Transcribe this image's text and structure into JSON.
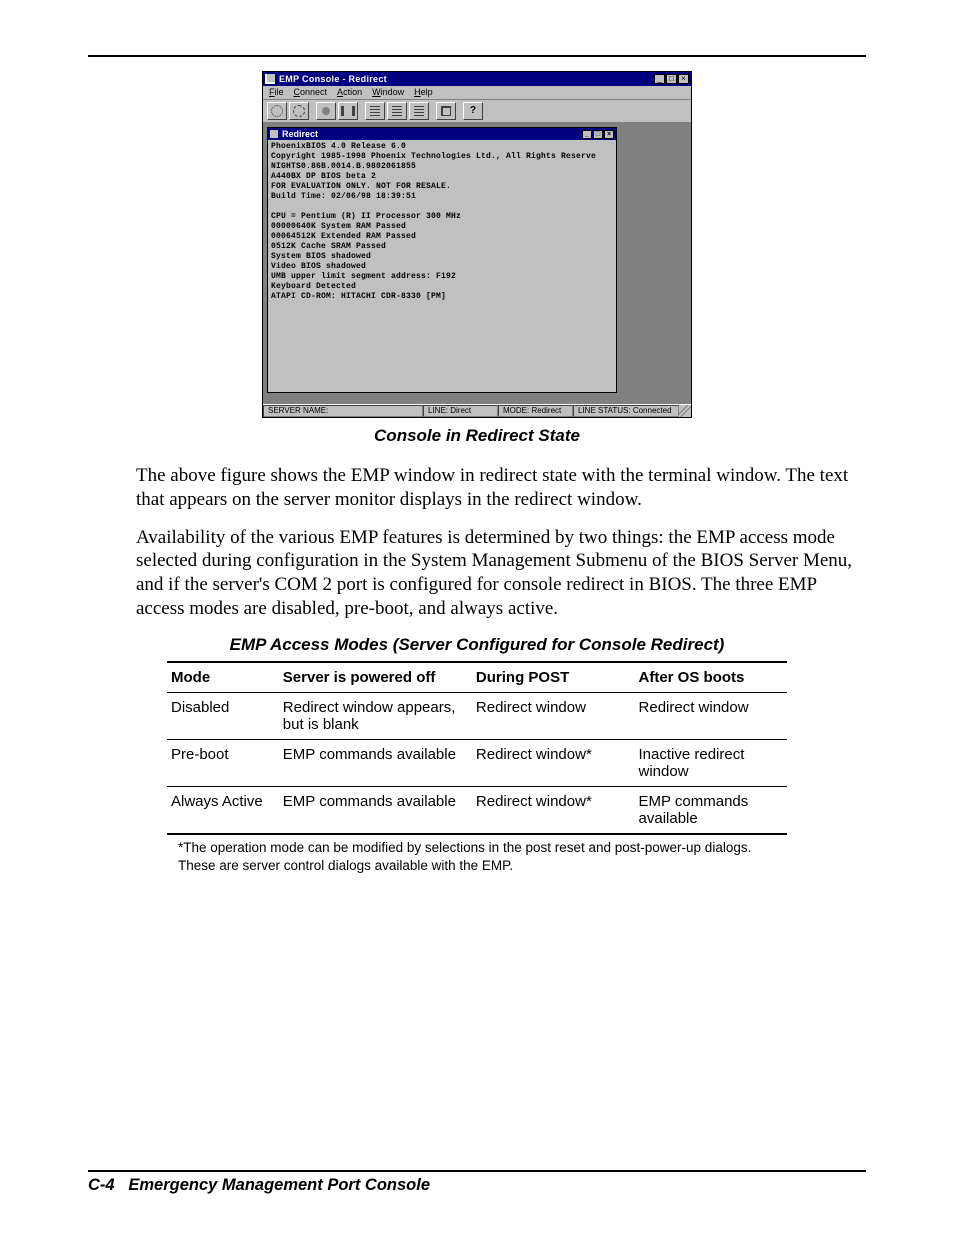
{
  "app": {
    "title": "EMP Console - Redirect",
    "menus": [
      "File",
      "Connect",
      "Action",
      "Window",
      "Help"
    ],
    "winbtns": {
      "min": "_",
      "max": "□",
      "close": "×"
    },
    "toolbar_icons": [
      "gear-icon",
      "gear2-icon",
      "dot-icon",
      "pause-icon",
      "bars-icon",
      "bars-icon",
      "bars-icon",
      "chip-icon",
      "help-icon"
    ]
  },
  "subwin": {
    "title": "Redirect",
    "terminal_lines": [
      "PhoenixBIOS 4.0 Release 6.0",
      "Copyright 1985-1998 Phoenix Technologies Ltd., All Rights Reserve",
      "NIGHTS0.86B.0014.B.9802061855",
      "A440BX DP BIOS beta 2",
      "FOR EVALUATION ONLY. NOT FOR RESALE.",
      "Build Time: 02/06/98 18:39:51",
      "",
      "CPU = Pentium (R) II Processor  300 MHz",
      "00000640K System RAM Passed",
      "00064512K Extended RAM Passed",
      "0512K Cache SRAM Passed",
      "System BIOS shadowed",
      "Video BIOS shadowed",
      "UMB upper limit segment address: F192",
      "Keyboard Detected",
      "ATAPI CD-ROM: HITACHI CDR-8330          [PM]"
    ]
  },
  "statusbar": {
    "server_name": "SERVER NAME:",
    "line": "LINE: Direct",
    "mode": "MODE: Redirect",
    "status": "LINE STATUS: Connected"
  },
  "figure_caption": "Console in Redirect State",
  "paragraphs": [
    "The above figure shows the EMP window in redirect state with the terminal window. The text that appears on the server monitor displays in the redirect window.",
    "Availability of the various EMP features is determined by two things: the EMP access mode selected during configuration in the System Management Submenu of the BIOS Server Menu, and if the server's COM 2 port is configured for console redirect in BIOS. The three EMP access modes are disabled, pre-boot, and always active."
  ],
  "table_caption": "EMP Access Modes (Server Configured for Console Redirect)",
  "table": {
    "headers": [
      "Mode",
      "Server is powered off",
      "During POST",
      "After OS boots"
    ],
    "rows": [
      [
        "Disabled",
        "Redirect window appears, but is blank",
        "Redirect window",
        "Redirect window"
      ],
      [
        "Pre-boot",
        "EMP commands available",
        "Redirect window*",
        "Inactive redirect window"
      ],
      [
        "Always Active",
        "EMP commands available",
        "Redirect window*",
        "EMP commands available"
      ]
    ]
  },
  "footnote": [
    "*The operation mode can be modified by selections in the post reset and post-power-up dialogs.",
    " These are server control dialogs available with the EMP."
  ],
  "footer": {
    "page": "C-4",
    "title": "Emergency Management Port Console"
  }
}
